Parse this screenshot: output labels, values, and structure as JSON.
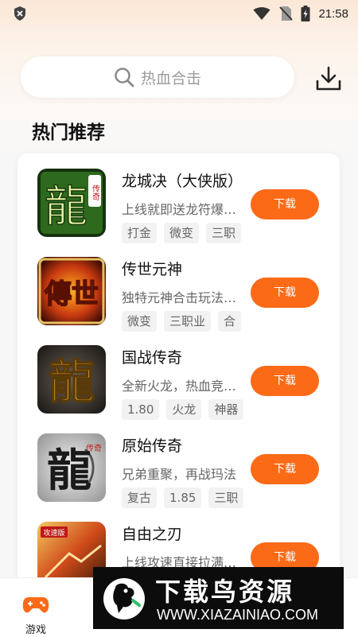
{
  "status_bar": {
    "time": "21:58"
  },
  "search": {
    "placeholder": "热血合击"
  },
  "section": {
    "title": "热门推荐"
  },
  "games": [
    {
      "name": "龙城决（大侠版）",
      "desc": "上线就即送龙符爆率…",
      "tags": [
        "打金",
        "微变",
        "三职"
      ],
      "button": "下载",
      "icon_text": "龍",
      "icon_side_text": "传奇"
    },
    {
      "name": "传世元神",
      "desc": "独特元神合击玩法，…",
      "tags": [
        "微变",
        "三职业",
        "合"
      ],
      "button": "下载",
      "icon_text": "傳世",
      "icon_side_text": ""
    },
    {
      "name": "国战传奇",
      "desc": "全新火龙，热血竞技…",
      "tags": [
        "1.80",
        "火龙",
        "神器"
      ],
      "button": "下载",
      "icon_text": "龍",
      "icon_side_text": ""
    },
    {
      "name": "原始传奇",
      "desc": "兄弟重聚，再战玛法",
      "tags": [
        "复古",
        "1.85",
        "三职"
      ],
      "button": "下载",
      "icon_text": "龍",
      "icon_side_text": "传奇"
    },
    {
      "name": "自由之刃",
      "desc": "上线攻速直接拉满!…",
      "tags": [],
      "button": "下载",
      "icon_text": "攻速版",
      "icon_side_text": ""
    }
  ],
  "bottom_nav": {
    "games_label": "游戏"
  },
  "watermark": {
    "title": "下载鸟资源",
    "url": "WWW.XIAZAINIAO.COM"
  },
  "colors": {
    "accent": "#fb6a17",
    "background": "#f7f7f7"
  }
}
